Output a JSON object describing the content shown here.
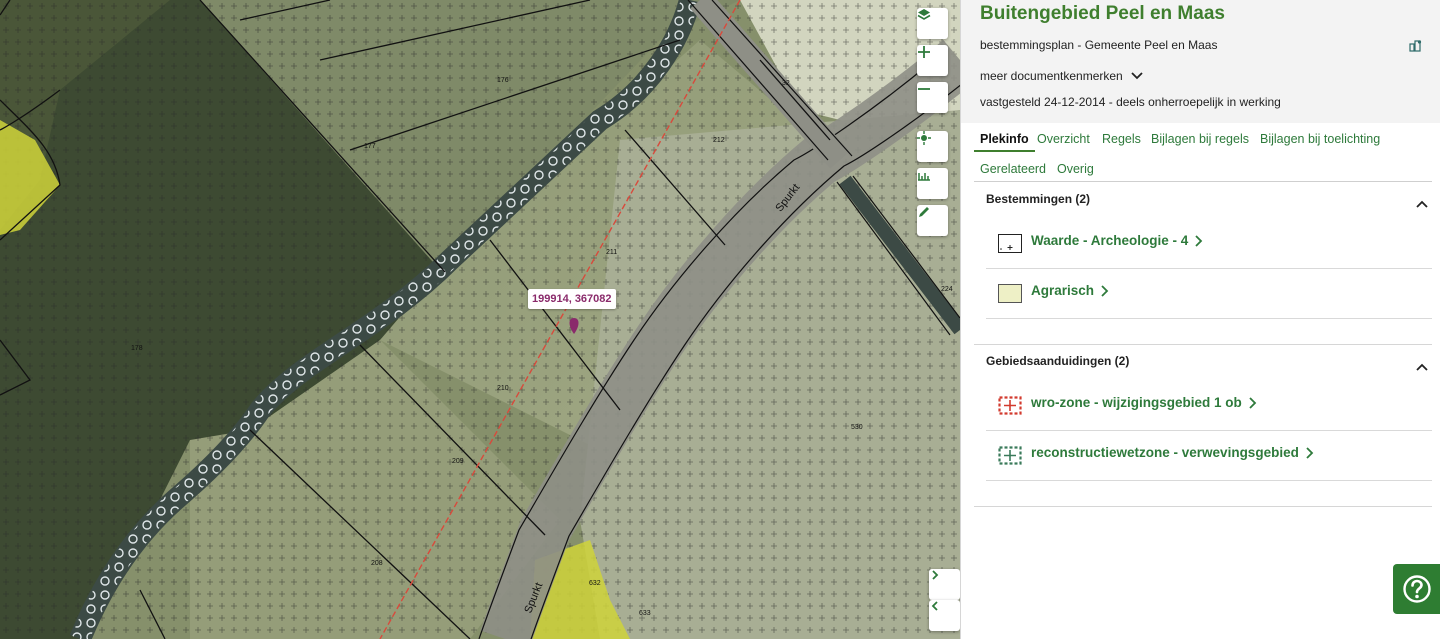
{
  "map": {
    "coordinate_label": "199914, 367082",
    "street_names": [
      "Spurkt",
      "Spurkt"
    ],
    "parcel_numbers": [
      "176",
      "177",
      "178",
      "32",
      "212",
      "211",
      "210",
      "209",
      "208",
      "224",
      "530",
      "632",
      "633"
    ],
    "controls": {
      "layers": "layers-icon",
      "zoom_in": "plus-icon",
      "zoom_out": "minus-icon",
      "locate": "location-icon",
      "measure": "ruler-icon",
      "draw": "pencil-icon",
      "next": "chevron-right-icon",
      "prev": "chevron-left-icon"
    }
  },
  "panel": {
    "title": "Buitengebied Peel en Maas",
    "plan_type": "bestemmingsplan - Gemeente Peel en Maas",
    "more_label": "meer documentkenmerken",
    "status": "vastgesteld 24-12-2014 - deels onherroepelijk in werking",
    "tabs": [
      {
        "label": "Plekinfo",
        "active": true
      },
      {
        "label": "Overzicht"
      },
      {
        "label": "Regels"
      },
      {
        "label": "Bijlagen bij regels"
      },
      {
        "label": "Bijlagen bij toelichting"
      },
      {
        "label": "Gerelateerd"
      },
      {
        "label": "Overig"
      }
    ],
    "sections": [
      {
        "heading": "Bestemmingen (2)",
        "items": [
          {
            "label": "Waarde - Archeologie - 4",
            "swatch": "archeologie"
          },
          {
            "label": "Agrarisch",
            "swatch": "agrarisch"
          }
        ]
      },
      {
        "heading": "Gebiedsaanduidingen (2)",
        "items": [
          {
            "label": "wro-zone - wijzigingsgebied 1 ob",
            "swatch": "wro"
          },
          {
            "label": "reconstructiewetzone - verwevingsgebied",
            "swatch": "reconstructie"
          }
        ]
      }
    ]
  },
  "colors": {
    "accent_green": "#2e7a3b",
    "title_green": "#3f7f2e",
    "marker": "#8a2a6b",
    "help_button": "#2e7d32"
  }
}
